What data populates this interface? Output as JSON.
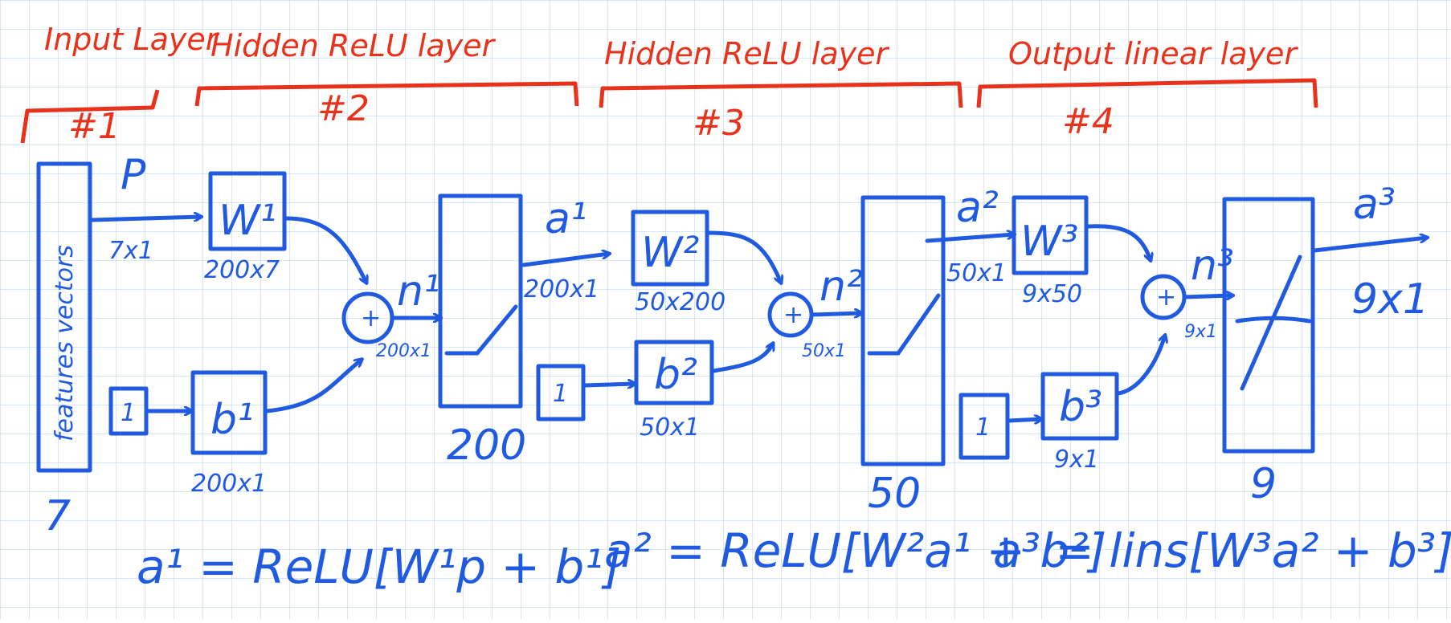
{
  "colors": {
    "grid": "#c9e1f3",
    "ink_blue": "#1f5ae0",
    "ink_red": "#e8321c",
    "paper": "#ffffff"
  },
  "layers": [
    {
      "title": "Input Layer",
      "number": "#1"
    },
    {
      "title": "Hidden ReLU layer",
      "number": "#2"
    },
    {
      "title": "Hidden ReLU layer",
      "number": "#3"
    },
    {
      "title": "Output linear layer",
      "number": "#4"
    }
  ],
  "input": {
    "vertical_text": "features vectors",
    "size": "7",
    "signal": "P",
    "signal_dim": "7x1"
  },
  "layer2": {
    "weight": "W¹",
    "weight_dim": "200x7",
    "bias_input": "1",
    "bias": "b¹",
    "bias_dim": "200x1",
    "sum": "+",
    "net": "n¹",
    "net_dim": "200x1",
    "units": "200",
    "output": "a¹",
    "output_dim": "200x1"
  },
  "layer3": {
    "weight": "W²",
    "weight_dim": "50x200",
    "bias_input": "1",
    "bias": "b²",
    "bias_dim": "50x1",
    "sum": "+",
    "net": "n²",
    "net_dim": "50x1",
    "units": "50",
    "output": "a²",
    "output_dim": "50x1"
  },
  "layer4": {
    "weight": "W³",
    "weight_dim": "9x50",
    "bias_input": "1",
    "bias": "b³",
    "bias_dim": "9x1",
    "sum": "+",
    "net": "n³",
    "net_dim": "9x1",
    "units": "9",
    "output": "a³",
    "output_dim": "9x1"
  },
  "equations": [
    "a¹ = ReLU[W¹p + b¹]",
    "a² = ReLU[W²a¹ + b²]",
    "a³ = lins[W³a² + b³]"
  ]
}
